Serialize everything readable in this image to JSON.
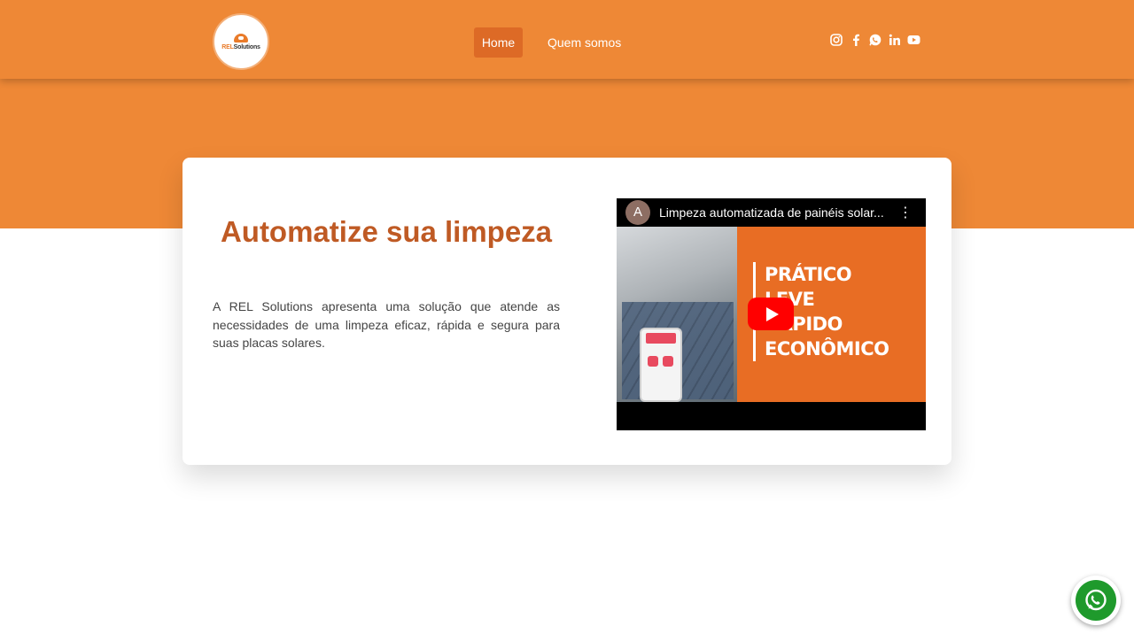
{
  "header": {
    "logo": {
      "text_prefix": "REL",
      "text_suffix": "Solutions"
    },
    "nav": [
      {
        "label": "Home",
        "active": true
      },
      {
        "label": "Quem somos",
        "active": false
      }
    ],
    "social_icons": [
      "instagram-icon",
      "facebook-icon",
      "whatsapp-icon",
      "linkedin-icon",
      "youtube-icon"
    ]
  },
  "hero": {
    "title": "Automatize sua limpeza",
    "description": "A REL Solutions apresenta uma solução que atende as necessidades de uma limpeza eficaz, rápida e segura para suas placas solares."
  },
  "video": {
    "channel_initial": "A",
    "title": "Limpeza automatizada de painéis solar...",
    "menu_glyph": "⋮",
    "thumbnail_words": [
      "PRÁTICO",
      "LEVE",
      "RÁPIDO",
      "ECONÔMICO"
    ]
  },
  "colors": {
    "brand_orange": "#ee8836",
    "active_nav": "#dd6a26",
    "title_color": "#bf5a24",
    "whatsapp_green": "#1f9a2c",
    "youtube_red": "#ff0000"
  }
}
